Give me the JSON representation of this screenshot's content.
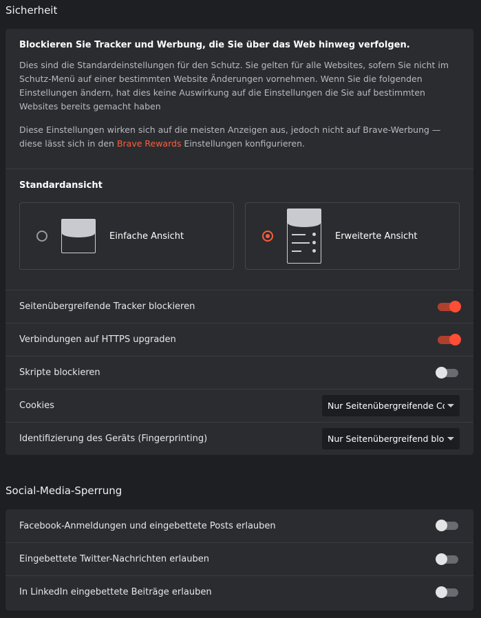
{
  "shields": {
    "section_title": "Sicherheit",
    "intro": {
      "heading": "Blockieren Sie Tracker und Werbung, die Sie über das Web hinweg verfolgen.",
      "paragraph1": "Dies sind die Standardeinstellungen für den Schutz. Sie gelten für alle Websites, sofern Sie nicht im Schutz-Menü auf einer bestimmten Website Änderungen vornehmen. Wenn Sie die folgenden Einstellungen ändern, hat dies keine Auswirkung auf die Einstellungen die Sie auf bestimmten Websites bereits gemacht haben",
      "paragraph2_before": "Diese Einstellungen wirken sich auf die meisten Anzeigen aus, jedoch nicht auf Brave-Werbung — diese lässt sich in den ",
      "paragraph2_link": "Brave Rewards",
      "paragraph2_after": " Einstellungen konfigurieren."
    },
    "default_view": {
      "heading": "Standardansicht",
      "simple_label": "Einfache Ansicht",
      "advanced_label": "Erweiterte Ansicht",
      "selected": "advanced"
    },
    "rows": {
      "cross_site_trackers": {
        "label": "Seitenübergreifende Tracker blockieren",
        "enabled": true
      },
      "https_upgrade": {
        "label": "Verbindungen auf HTTPS upgraden",
        "enabled": true
      },
      "block_scripts": {
        "label": "Skripte blockieren",
        "enabled": false
      },
      "cookies": {
        "label": "Cookies",
        "selected": "Nur Seitenübergreifende Cookies blockieren"
      },
      "fingerprinting": {
        "label": "Identifizierung des Geräts (Fingerprinting)",
        "selected": "Nur Seitenübergreifend blockieren"
      }
    }
  },
  "social": {
    "section_title": "Social-Media-Sperrung",
    "rows": {
      "facebook": {
        "label": "Facebook-Anmeldungen und eingebettete Posts erlauben",
        "enabled": false
      },
      "twitter": {
        "label": "Eingebettete Twitter-Nachrichten erlauben",
        "enabled": false
      },
      "linkedin": {
        "label": "In LinkedIn eingebettete Beiträge erlauben",
        "enabled": false
      }
    }
  },
  "colors": {
    "accent": "#ff4d36",
    "link": "#ff5d3a",
    "card_bg": "#2b2c30",
    "page_bg": "#1e1f22"
  }
}
